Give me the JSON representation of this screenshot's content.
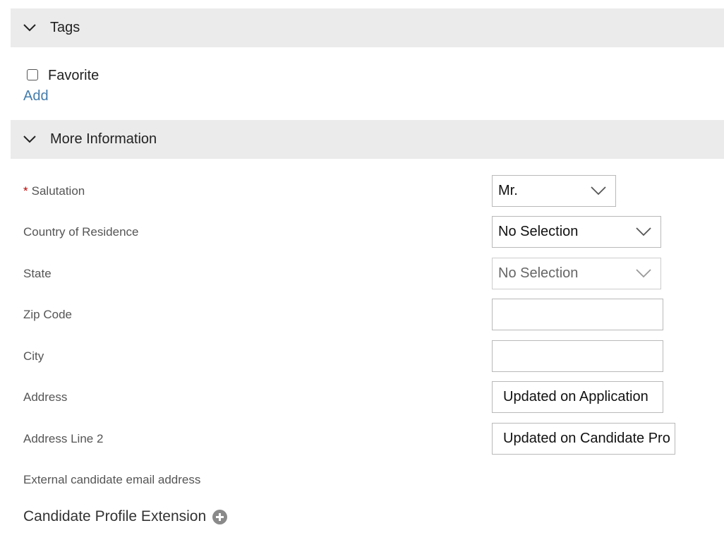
{
  "sections": {
    "tags": {
      "title": "Tags",
      "expanded": true
    },
    "more_info": {
      "title": "More Information",
      "expanded": true
    }
  },
  "tags": {
    "favorite_label": "Favorite",
    "favorite_checked": false,
    "add_label": "Add"
  },
  "form": {
    "salutation": {
      "label": "Salutation",
      "required": true,
      "value": "Mr."
    },
    "country": {
      "label": "Country of Residence",
      "value": "No Selection"
    },
    "state": {
      "label": "State",
      "value": "No Selection",
      "disabled": true
    },
    "zip": {
      "label": "Zip Code",
      "value": ""
    },
    "city": {
      "label": "City",
      "value": ""
    },
    "address": {
      "label": "Address",
      "value": "Updated on Application"
    },
    "address2": {
      "label": "Address Line 2",
      "value": "Updated on Candidate Pro"
    },
    "external_email": {
      "label": "External candidate email address"
    }
  },
  "extension": {
    "title": "Candidate Profile Extension",
    "add_icon": "plus-circle-icon"
  },
  "colors": {
    "header_bg": "#ebebeb",
    "link": "#427cac",
    "required": "#bb0000"
  }
}
